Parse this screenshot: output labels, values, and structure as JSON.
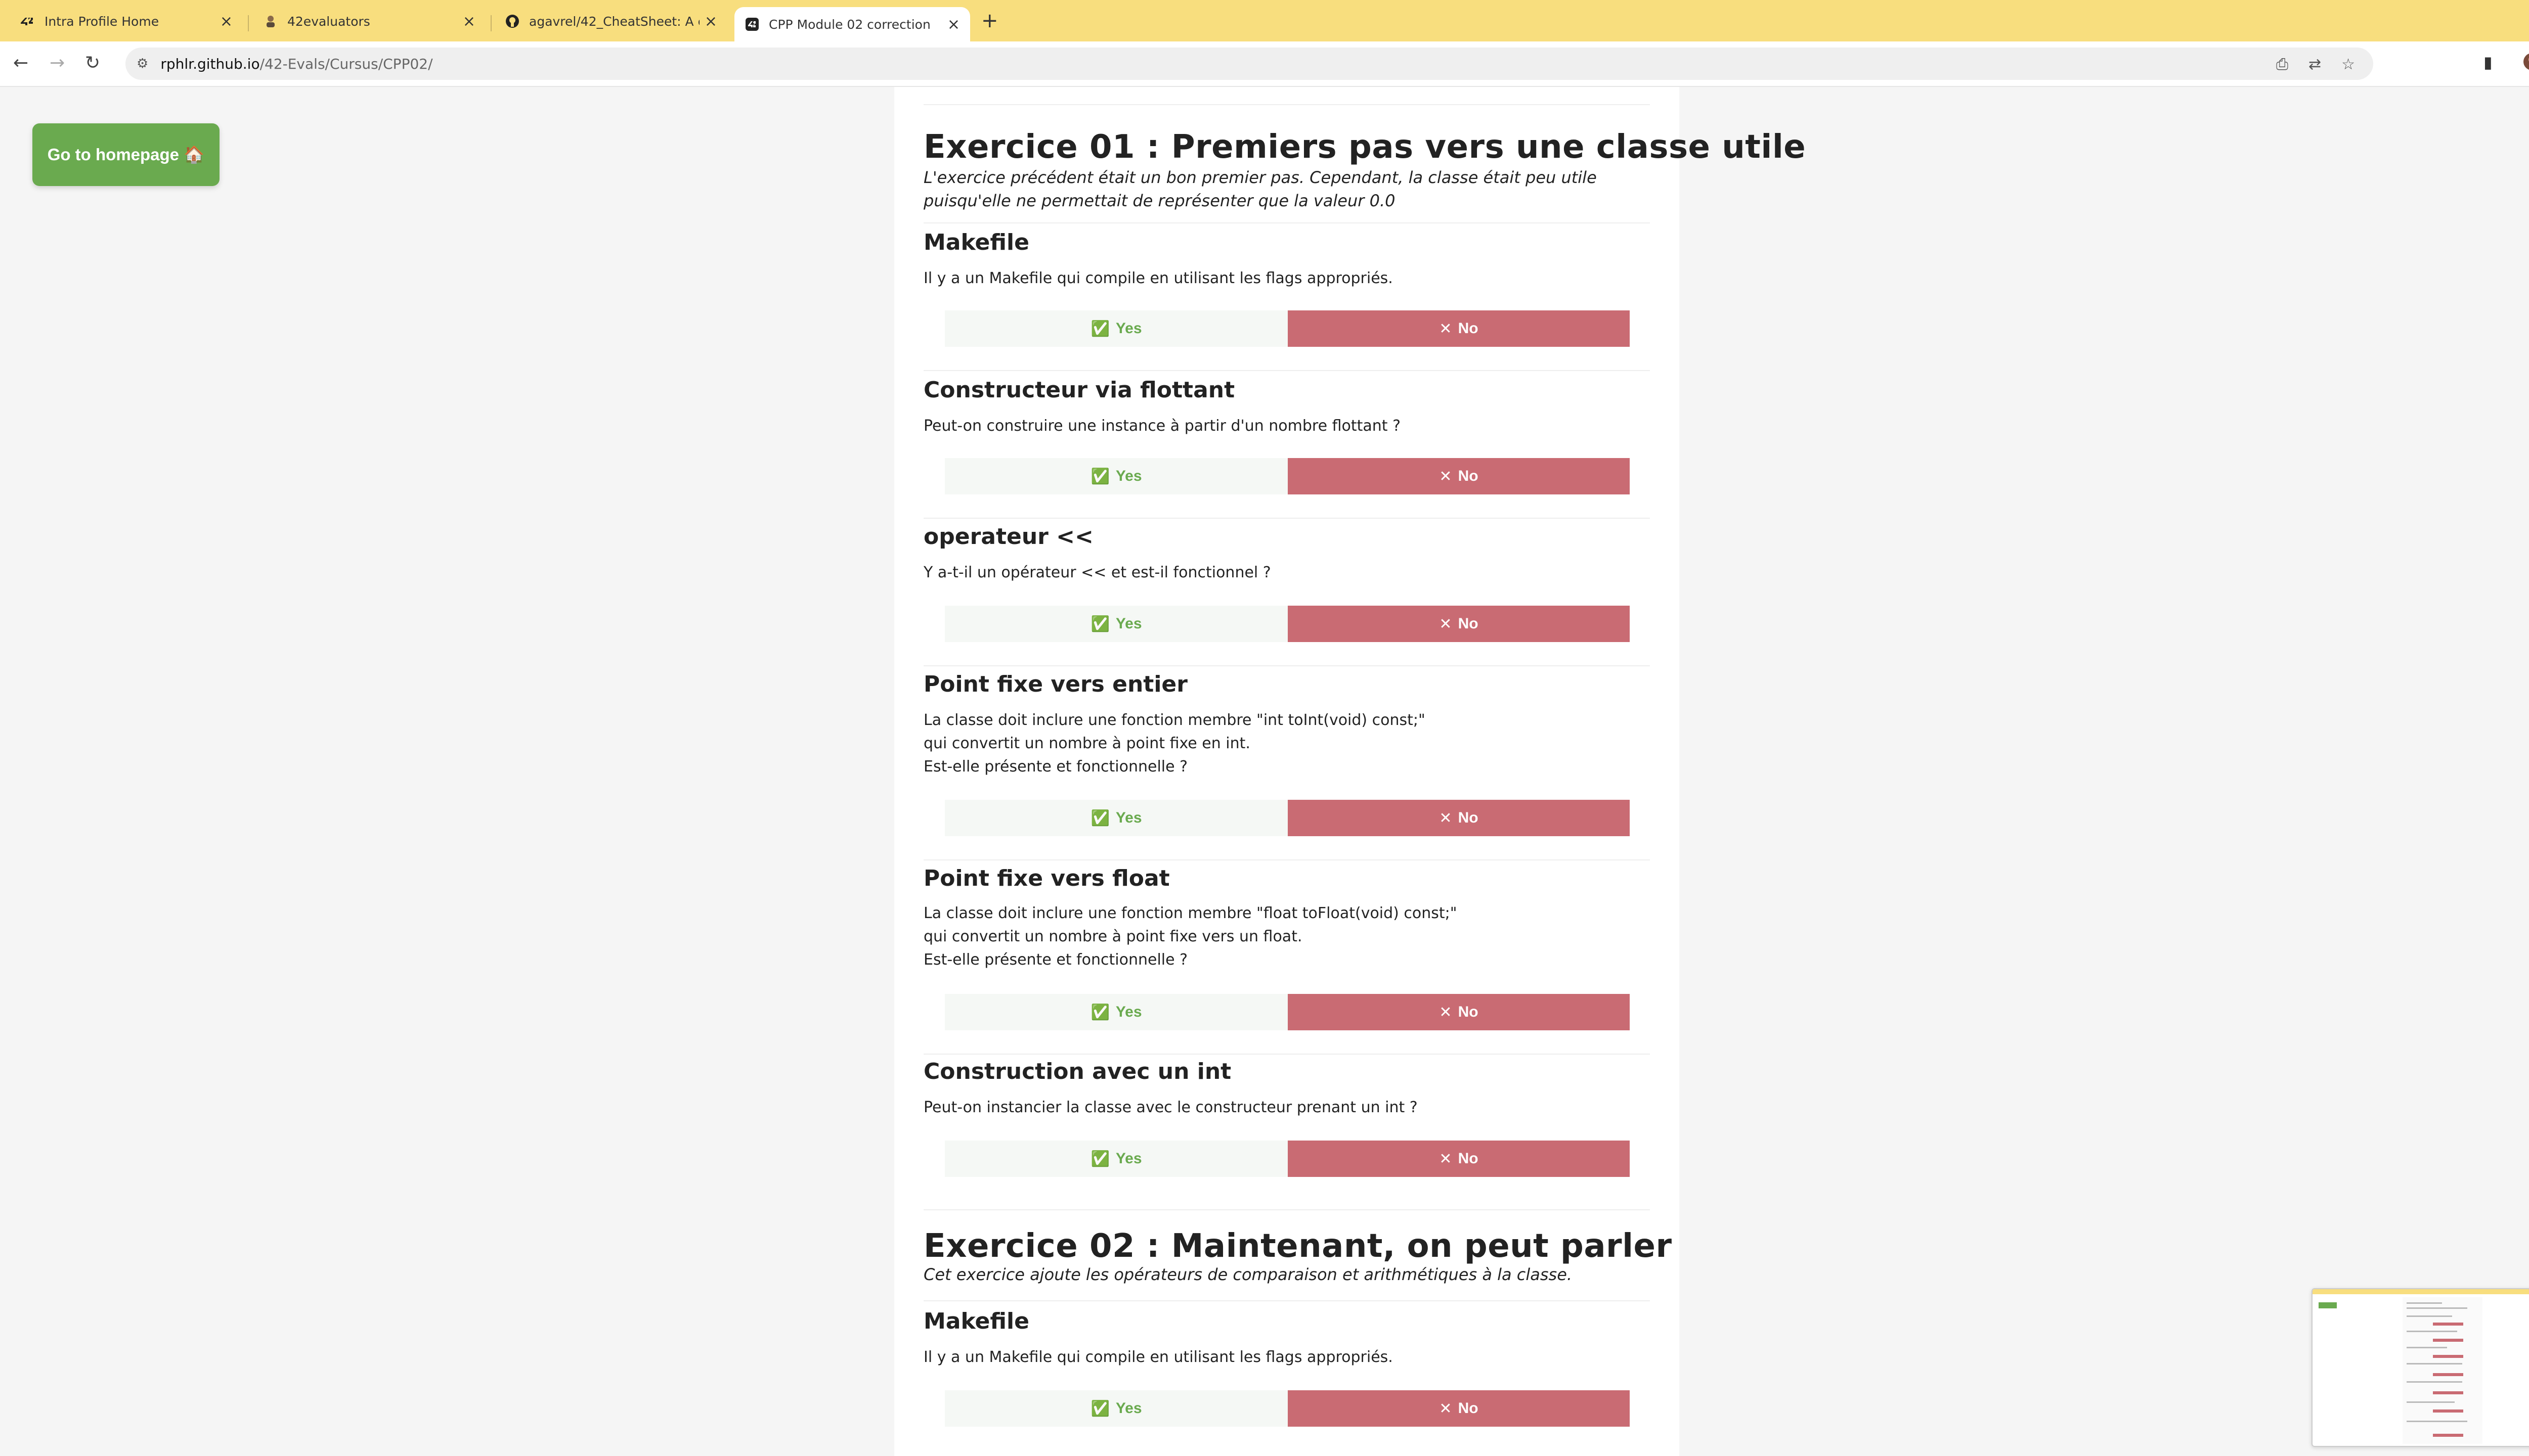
{
  "browser": {
    "tabs": [
      {
        "title": "Intra Profile Home",
        "icon": "42-logo-icon"
      },
      {
        "title": "42evaluators",
        "icon": "person-icon"
      },
      {
        "title": "agavrel/42_CheatSheet: A co",
        "icon": "github-icon"
      },
      {
        "title": "CPP Module 02 correction",
        "icon": "42-logo-icon"
      }
    ],
    "new_tab": "+",
    "url_host": "rphlr.github.io",
    "url_path": "/42-Evals/Cursus/CPP02/"
  },
  "page": {
    "home_button": "Go to homepage 🏠",
    "yes_label": "Yes",
    "no_label": "No",
    "exercise1": {
      "title": "Exercice 01 : Premiers pas vers une classe utile",
      "description": "L'exercice précédent était un bon premier pas. Cependant, la classe était peu utile puisqu'elle ne permettait de représenter que la valeur 0.0",
      "questions": [
        {
          "title": "Makefile",
          "text": "Il y a un Makefile qui compile en utilisant les flags appropriés."
        },
        {
          "title": "Constructeur via flottant",
          "text": "Peut-on construire une instance à partir d'un nombre flottant ?"
        },
        {
          "title": "operateur <<",
          "text": "Y a-t-il un opérateur << et est-il fonctionnel ?"
        },
        {
          "title": "Point fixe vers entier",
          "text": "La classe doit inclure une fonction membre \"int toInt(void) const;\"\nqui convertit un nombre à point fixe en int.\nEst-elle présente et fonctionnelle ?"
        },
        {
          "title": "Point fixe vers float",
          "text": "La classe doit inclure une fonction membre \"float toFloat(void) const;\"\nqui convertit un nombre à point fixe vers un float.\nEst-elle présente et fonctionnelle ?"
        },
        {
          "title": "Construction avec un int",
          "text": "Peut-on instancier la classe avec le constructeur prenant un int ?"
        }
      ]
    },
    "exercise2": {
      "title": "Exercice 02 : Maintenant, on peut parler",
      "description": "Cet exercice ajoute les opérateurs de comparaison et arithmétiques à la classe.",
      "questions": [
        {
          "title": "Makefile",
          "text": "Il y a un Makefile qui compile en utilisant les flags appropriés."
        }
      ]
    }
  },
  "colors": {
    "tabbar": "#f8de7e",
    "yes_green": "#6aaa4f",
    "no_red": "#c96b73"
  }
}
